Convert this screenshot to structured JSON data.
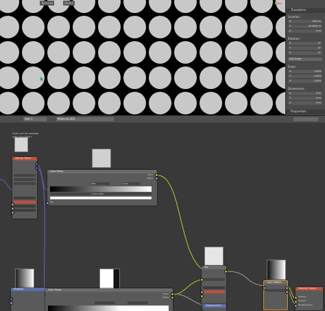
{
  "viewport": {
    "view_label": "Textured",
    "shading_label": "Global"
  },
  "properties": {
    "transform_header": "Transform",
    "location_label": "Location:",
    "location": [
      {
        "axis": "X",
        "value": "16.4 m"
      },
      {
        "axis": "Y",
        "value": "-8.5423 m"
      },
      {
        "axis": "Z",
        "value": "0 m"
      }
    ],
    "rotation_label": "Rotation:",
    "rotation": [
      {
        "axis": "X",
        "value": "0°"
      },
      {
        "axis": "Y",
        "value": "0°"
      },
      {
        "axis": "Z",
        "value": "0°"
      }
    ],
    "rotation_mode": "XYZ Euler",
    "scale_label": "Scale:",
    "scale": [
      {
        "axis": "X",
        "value": "1.000"
      },
      {
        "axis": "Y",
        "value": "1.000"
      },
      {
        "axis": "Z",
        "value": "1.000"
      }
    ],
    "dimensions_label": "Dimensions:",
    "dimensions": [
      {
        "axis": "X",
        "value": "0 m"
      },
      {
        "axis": "Y",
        "value": "0 m"
      },
      {
        "axis": "Z",
        "value": "0 m"
      }
    ],
    "properties_header": "Properties"
  },
  "node_editor": {
    "slot_label": "Slot 1",
    "material_name": "Material.004",
    "note": "Scale can be tweaked with Ctrl+Shift+",
    "nodes": {
      "texture_coordinate": {
        "title": "Texture Coord"
      },
      "color_ramp_top": {
        "title": "Color Ramp",
        "out_color": "Color",
        "out_alpha": "Alpha",
        "in_fac": "Fac",
        "field_a": "RGB",
        "field_b": "Linear",
        "pos_label": "Pos",
        "pos_value": "0.000"
      },
      "mix_top": {
        "title": "Mix",
        "out_color": "Color",
        "in_a": "Color1",
        "in_b": "Color2",
        "fac_label": "Fac"
      },
      "displacement": {
        "title": "Displacement"
      },
      "color_ramp_bottom": {
        "title": "Color Ramp",
        "out_color": "Color",
        "out_alpha": "Alpha"
      },
      "mapping": {
        "title": "Mapping",
        "out_label": "Vector"
      },
      "material_output": {
        "title": "Material Output",
        "in_surface": "Surface",
        "in_volume": "Volume",
        "in_disp": "Displacement"
      },
      "layer_node": {
        "title": "Layer Weight"
      }
    }
  }
}
